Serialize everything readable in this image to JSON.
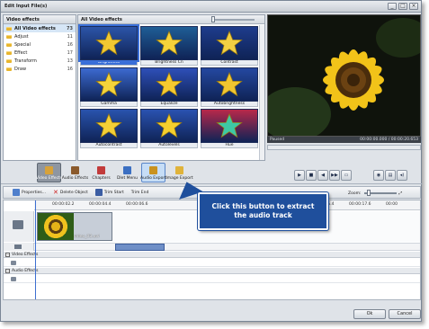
{
  "window": {
    "title": "Edit Input File(s)"
  },
  "categories": {
    "header": "Video effects",
    "items": [
      {
        "label": "All Video effects",
        "count": "73"
      },
      {
        "label": "Adjust",
        "count": "11"
      },
      {
        "label": "Special",
        "count": "16"
      },
      {
        "label": "Effect",
        "count": "17"
      },
      {
        "label": "Transform",
        "count": "13"
      },
      {
        "label": "Draw",
        "count": "16"
      }
    ]
  },
  "effects": {
    "header": "All Video effects",
    "items": [
      {
        "label": "Brightness",
        "star_color": "#f2c832",
        "bg": "#2c55a8"
      },
      {
        "label": "Brightness Cn",
        "star_color": "#f5d23a",
        "bg": "#1f5e96"
      },
      {
        "label": "Contrast",
        "star_color": "#f3d043",
        "bg": "#1e3c8c"
      },
      {
        "label": "Gamma",
        "star_color": "#f4d33a",
        "bg": "#3c6ad0"
      },
      {
        "label": "Equalize",
        "star_color": "#f6c92f",
        "bg": "#2e4fb8"
      },
      {
        "label": "Autobrightness",
        "star_color": "#f1c630",
        "bg": "#2448a0"
      },
      {
        "label": "Autocontrast",
        "star_color": "#f3cf36",
        "bg": "#2953ad"
      },
      {
        "label": "Autolevels",
        "star_color": "#f5cf2e",
        "bg": "#2a52b0"
      },
      {
        "label": "Hue",
        "star_color": "#3ec9a5",
        "bg": "#b8284a"
      }
    ]
  },
  "preview": {
    "status": "Paused",
    "time": "00:00:00.000 / 00:00:20.653"
  },
  "toolbar": {
    "tools": [
      {
        "label": "Video Effects",
        "icon_color": "#d7a23a"
      },
      {
        "label": "Audio Effects",
        "icon_color": "#8a5a2c"
      },
      {
        "label": "Chapters",
        "icon_color": "#c23b3b"
      },
      {
        "label": "Dlet Menu",
        "icon_color": "#3b6fc2"
      },
      {
        "label": "Audio Export",
        "icon_color": "#c9921f"
      },
      {
        "label": "Image Export",
        "icon_color": "#e0b33a"
      }
    ]
  },
  "timeline_toolbar": {
    "properties": "Properties...",
    "delete": "Delete Object",
    "trim_start": "Trim Start",
    "trim_end": "Trim End",
    "zoom": "Zoom:"
  },
  "timeline": {
    "ruler": [
      "00:00:02.2",
      "00:00:04.4",
      "00:00:06.6",
      "00:00:15.4",
      "00:00:17.6",
      "00:00"
    ],
    "clip_name": "video_03.avi",
    "video_effects_label": "Video Effects",
    "audio_effects_label": "Audio Effects"
  },
  "callout": {
    "text": "Click this button to extract the audio track"
  },
  "footer": {
    "ok": "Ok",
    "cancel": "Cancel"
  }
}
